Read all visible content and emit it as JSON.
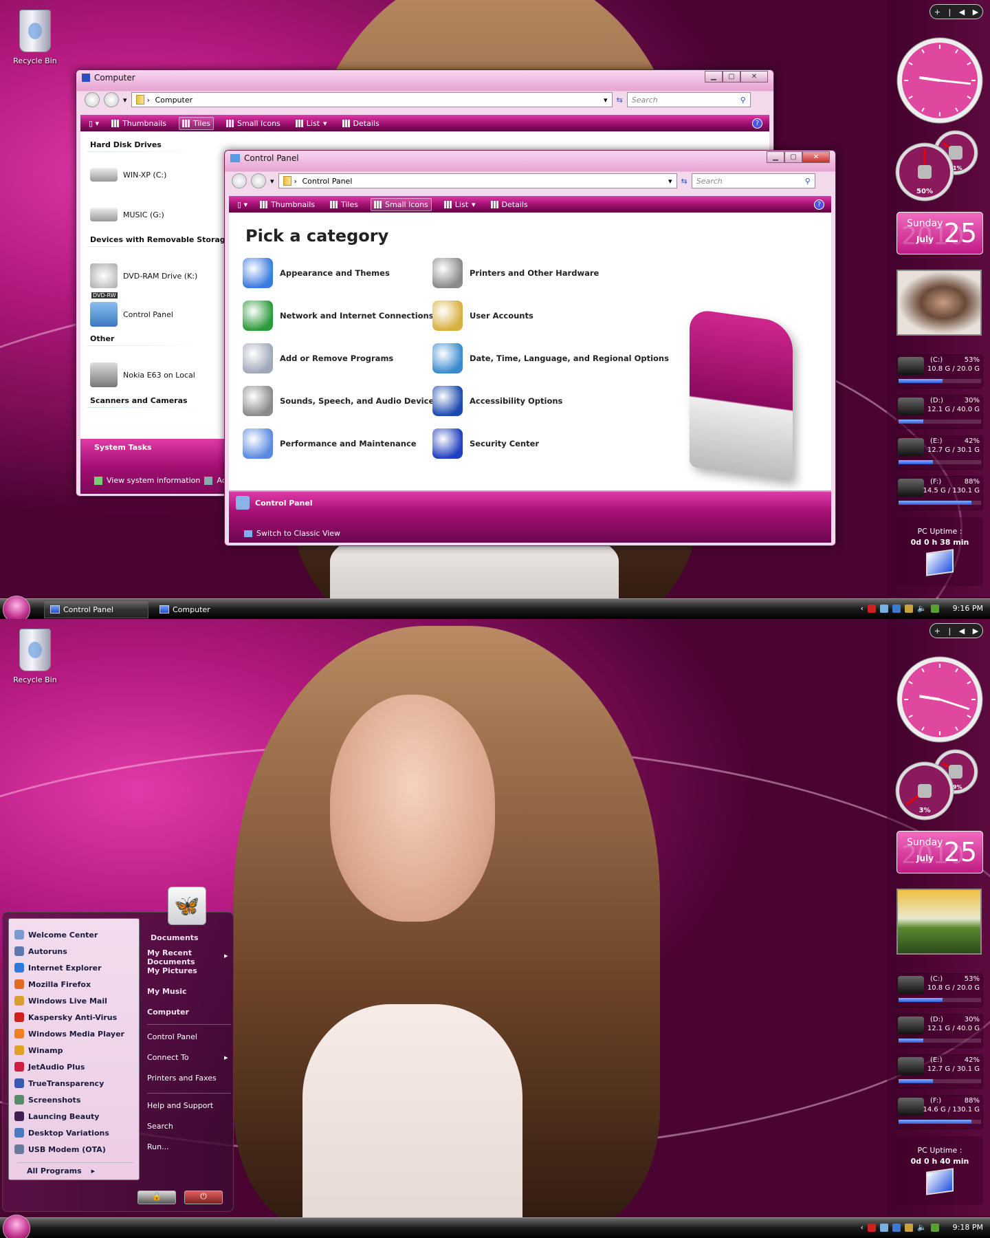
{
  "colors": {
    "accent": "#b0187c",
    "toolbar": "#9d0d6e",
    "bar_fill": "#2d58d8"
  },
  "desktop": {
    "recycle_bin": "Recycle Bin"
  },
  "top": {
    "computer_window": {
      "title": "Computer",
      "address": "Computer",
      "search_placeholder": "Search",
      "toolbar": [
        "Thumbnails",
        "Tiles",
        "Small Icons",
        "List",
        "Details"
      ],
      "active_view": "Tiles",
      "groups": [
        {
          "name": "Hard Disk Drives",
          "items": [
            "WIN-XP (C:)",
            "MUSIC (G:)"
          ]
        },
        {
          "name": "Devices with Removable Storage",
          "items": [
            "DVD-RAM Drive (K:)"
          ]
        },
        {
          "name": "Other",
          "items": [
            "Control Panel"
          ]
        },
        {
          "name": "Scanners and Cameras",
          "items": [
            "Nokia E63 on Local"
          ]
        }
      ],
      "dvd_badge": "DVD-RW",
      "system_tasks": {
        "title": "System Tasks",
        "items": [
          "View system information",
          "Add o"
        ]
      }
    },
    "control_panel": {
      "title": "Control Panel",
      "address": "Control Panel",
      "search_placeholder": "Search",
      "toolbar": [
        "Thumbnails",
        "Tiles",
        "Small Icons",
        "List",
        "Details"
      ],
      "active_view": "Small Icons",
      "heading": "Pick a category",
      "categories": [
        {
          "label": "Appearance and Themes",
          "icon": "appearance-icon",
          "color": "#3a7be0"
        },
        {
          "label": "Printers and Other Hardware",
          "icon": "printer-icon",
          "color": "#8a8a8a"
        },
        {
          "label": "Network and Internet Connections",
          "icon": "network-icon",
          "color": "#2d9a3a"
        },
        {
          "label": "User Accounts",
          "icon": "user-accounts-icon",
          "color": "#d8b040"
        },
        {
          "label": "Add or Remove Programs",
          "icon": "programs-icon",
          "color": "#a0a8b8"
        },
        {
          "label": "Date, Time, Language, and Regional Options",
          "icon": "globe-calendar-icon",
          "color": "#3a8ad0"
        },
        {
          "label": "Sounds, Speech, and Audio Devices",
          "icon": "speaker-icon",
          "color": "#8a8a8a"
        },
        {
          "label": "Accessibility Options",
          "icon": "accessibility-icon",
          "color": "#1d4ab0"
        },
        {
          "label": "Performance and Maintenance",
          "icon": "pie-chart-icon",
          "color": "#5a8ae0"
        },
        {
          "label": "Security Center",
          "icon": "flag-icon",
          "color": "#2040c0"
        }
      ],
      "bottom_panel": {
        "title": "Control Panel",
        "link": "Switch to Classic View"
      }
    },
    "taskbar": {
      "buttons": [
        "Control Panel",
        "Computer"
      ],
      "time": "9:16 PM"
    },
    "sidebar": {
      "controls": [
        "+",
        "|",
        "◀",
        "▶"
      ],
      "clock": {
        "hour": 9,
        "minute": 16
      },
      "cpu_percent": 50,
      "ram_percent": 31,
      "date": {
        "weekday": "Sunday",
        "month": "July",
        "day": "25",
        "year": "2010"
      },
      "photo": "portrait",
      "drives": [
        {
          "name": "(C:)",
          "percent": 53,
          "usage": "10.8 G / 20.0 G"
        },
        {
          "name": "(D:)",
          "percent": 30,
          "usage": "12.1 G / 40.0 G"
        },
        {
          "name": "(E:)",
          "percent": 42,
          "usage": "12.7 G / 30.1 G"
        },
        {
          "name": "(F:)",
          "percent": 88,
          "usage": "14.5 G / 130.1 G"
        }
      ],
      "uptime": {
        "label": "PC Uptime :",
        "value": "0d 0 h 38 min"
      }
    }
  },
  "bottom": {
    "start_menu": {
      "programs": [
        {
          "label": "Welcome Center",
          "color": "#7a9ad0"
        },
        {
          "label": "Autoruns",
          "color": "#5a7ab0"
        },
        {
          "label": "Internet Explorer",
          "color": "#2d7ae0"
        },
        {
          "label": "Mozilla Firefox",
          "color": "#e06a20"
        },
        {
          "label": "Windows Live Mail",
          "color": "#d8a030"
        },
        {
          "label": "Kaspersky Anti-Virus",
          "color": "#d02020"
        },
        {
          "label": "Windows Media Player",
          "color": "#f08020"
        },
        {
          "label": "Winamp",
          "color": "#e0a020"
        },
        {
          "label": "JetAudio Plus",
          "color": "#d02040"
        },
        {
          "label": "TrueTransparency",
          "color": "#3a5ab0"
        },
        {
          "label": "Screenshots",
          "color": "#5a8a6a"
        },
        {
          "label": "Launcing Beauty",
          "color": "#402050"
        },
        {
          "label": "Desktop Variations",
          "color": "#4a7ac0"
        },
        {
          "label": "USB Modem (OTA)",
          "color": "#6a7a9a"
        }
      ],
      "all_programs": "All Programs",
      "right_bold": [
        "Documents",
        "My Recent Documents",
        "My Pictures",
        "My Music",
        "Computer"
      ],
      "right_normal_1": [
        "Control Panel",
        "Connect To",
        "Printers and Faxes"
      ],
      "right_normal_2": [
        "Help and Support",
        "Search",
        "Run..."
      ]
    },
    "taskbar": {
      "time": "9:18 PM"
    },
    "sidebar": {
      "controls": [
        "+",
        "|",
        "◀",
        "▶"
      ],
      "clock": {
        "hour": 9,
        "minute": 18
      },
      "cpu_percent": 3,
      "ram_percent": 29,
      "date": {
        "weekday": "Sunday",
        "month": "July",
        "day": "25",
        "year": "2010"
      },
      "photo": "landscape",
      "drives": [
        {
          "name": "(C:)",
          "percent": 53,
          "usage": "10.8 G / 20.0 G"
        },
        {
          "name": "(D:)",
          "percent": 30,
          "usage": "12.1 G / 40.0 G"
        },
        {
          "name": "(E:)",
          "percent": 42,
          "usage": "12.7 G / 30.1 G"
        },
        {
          "name": "(F:)",
          "percent": 88,
          "usage": "14.6 G / 130.1 G"
        }
      ],
      "uptime": {
        "label": "PC Uptime :",
        "value": "0d 0 h 40 min"
      }
    }
  }
}
